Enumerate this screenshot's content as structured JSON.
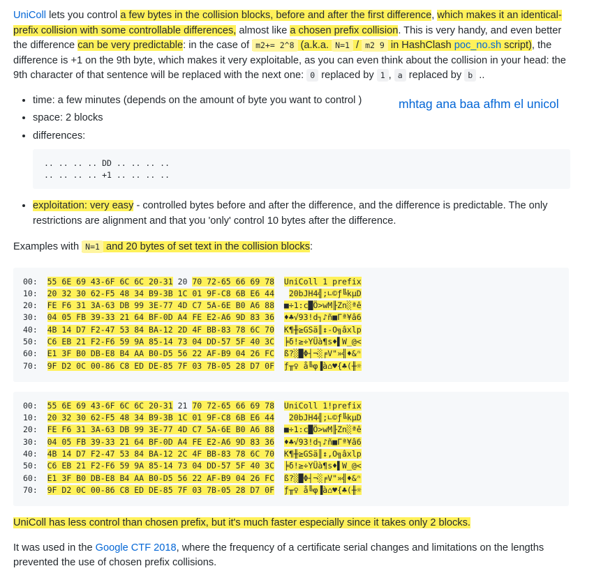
{
  "intro": {
    "unicoll_link": "UniColl",
    "t1": " lets you control ",
    "h1": "a few bytes in the collision blocks, before and after the first difference",
    "t2": ", ",
    "h2": "which makes it an identical-prefix collision with some controllable differences,",
    "t3": " almost like ",
    "h3": "a chosen prefix collision",
    "t4": ". This is very handy, and even better the difference ",
    "h4": "can be very predictable",
    "t5": ": in the case of ",
    "code_m2": "m2+= 2^8",
    "h5a": " (a.k.a. ",
    "code_n1": "N=1",
    "h5b": " / ",
    "code_m29": "m2 9",
    "h5c": " in HashClash ",
    "poc_link": "poc_no.sh",
    "h5d": " script)",
    "t6": ", the difference is +1 on the 9th byte, which makes it very exploitable, as you can even think about the collision in your head: the 9th character of that sentence will be replaced with the next one: ",
    "code_0": "0",
    "t7": " replaced by ",
    "code_1": "1",
    "t8": ", ",
    "code_a": "a",
    "t9": " replaced by ",
    "code_b": "b",
    "t10": " .."
  },
  "bullets": {
    "time": "time: a few minutes (depends on the amount of byte you want to control )",
    "space": "space: 2 blocks",
    "differences": "differences:",
    "diff_line1": ".. .. .. .. DD .. .. .. ..",
    "diff_line2": ".. .. .. .. +1 .. .. .. .."
  },
  "annotation": "mhtag ana baa afhm el unicol",
  "exploitation": {
    "label": "exploitation: very easy",
    "text": " - controlled bytes before and after the difference, and the difference is predictable. The only restrictions are alignment and that you 'only' control 10 bytes after the difference."
  },
  "examples": {
    "t1": "Examples with ",
    "code_n1": "N=1",
    "h1": " and 20 bytes of set text in the collision blocks",
    "t2": ":"
  },
  "hex_block_1": [
    {
      "off": "00:  ",
      "a": "55 6E 69 43-6F 6C 6C 20-31",
      "m": " 20 ",
      "b": "70 72-65 66 69 78",
      "sp": "  ",
      "asc": "UniColl 1 prefix"
    },
    {
      "off": "10:  ",
      "a": "20 32 30 62-F5 48 34 B9-3B 1C 01 9F-C8 6B E6 44",
      "m": "",
      "b": "",
      "sp": "   ",
      "asc": "20bJH4╣;∟©ƒ╚kµD"
    },
    {
      "off": "20:  ",
      "a": "FE F6 31 3A-63 DB 99 3E-77 4D C7 5A-6E B0 A6 88",
      "m": "",
      "b": "",
      "sp": "  ",
      "asc": "■÷1:c█Ö>wM╟Zn░ªê"
    },
    {
      "off": "30:  ",
      "a": "04 05 FB 39-33 21 64 BF-0D A4 FE E2-A6 9D 83 36",
      "m": "",
      "b": "",
      "sp": "  ",
      "asc": "♦♣√93!d┐♪ñ■Γª¥â6"
    },
    {
      "off": "40:  ",
      "a": "4B 14 D7 F2-47 53 84 BA-12 2D 4F BB-83 78 6C 70",
      "m": "",
      "b": "",
      "sp": "  ",
      "asc": "K¶╫≥GSä║↕-O╗âxlp"
    },
    {
      "off": "50:  ",
      "a": "C6 EB 21 F2-F6 59 9A 85-14 73 04 DD-57 5F 40 3C",
      "m": "",
      "b": "",
      "sp": "  ",
      "asc": "╞δ!≥÷YÜà¶s♦▌W_@<"
    },
    {
      "off": "60:  ",
      "a": "E1 3F B0 DB-E8 B4 AA B0-D5 56 22 AF-B9 04 26 FC",
      "m": "",
      "b": "",
      "sp": "  ",
      "asc": "ß?░█Φ┤¬░╒V\"»╣♦&ⁿ"
    },
    {
      "off": "70:  ",
      "a": "9F D2 0C 00-86 C8 ED DE-85 7F 03 7B-05 28 D7 0F",
      "m": "",
      "b": "",
      "sp": "  ",
      "asc": "ƒ╥♀ å╚φ▐à⌂♥{♣(╫☼"
    }
  ],
  "hex_block_2": [
    {
      "off": "00:  ",
      "a": "55 6E 69 43-6F 6C 6C 20-31",
      "m": " 21 ",
      "b": "70 72-65 66 69 78",
      "sp": "  ",
      "asc": "UniColl 1!prefix"
    },
    {
      "off": "10:  ",
      "a": "20 32 30 62-F5 48 34 B9-3B 1C 01 9F-C8 6B E6 44",
      "m": "",
      "b": "",
      "sp": "   ",
      "asc": "20bJH4╣;∟©ƒ╚kµD"
    },
    {
      "off": "20:  ",
      "a": "FE F6 31 3A-63 DB 99 3E-77 4D C7 5A-6E B0 A6 88",
      "m": "",
      "b": "",
      "sp": "  ",
      "asc": "■÷1:c█Ö>wM╟Zn░ªê"
    },
    {
      "off": "30:  ",
      "a": "04 05 FB 39-33 21 64 BF-0D A4 FE E2-A6 9D 83 36",
      "m": "",
      "b": "",
      "sp": "  ",
      "asc": "♦♣√93!d┐♪ñ■Γª¥â6"
    },
    {
      "off": "40:  ",
      "a": "4B 14 D7 F2-47 53 84 BA-12 2C 4F BB-83 78 6C 70",
      "m": "",
      "b": "",
      "sp": "  ",
      "asc": "K¶╫≥GSä║↕,O╗âxlp"
    },
    {
      "off": "50:  ",
      "a": "C6 EB 21 F2-F6 59 9A 85-14 73 04 DD-57 5F 40 3C",
      "m": "",
      "b": "",
      "sp": "  ",
      "asc": "╞δ!≥÷YÜà¶s♦▌W_@<"
    },
    {
      "off": "60:  ",
      "a": "E1 3F B0 DB-E8 B4 AA B0-D5 56 22 AF-B9 04 26 FC",
      "m": "",
      "b": "",
      "sp": "  ",
      "asc": "ß?░█Φ┤¬░╒V\"»╣♦&ⁿ"
    },
    {
      "off": "70:  ",
      "a": "9F D2 0C 00-86 C8 ED DE-85 7F 03 7B-05 28 D7 0F",
      "m": "",
      "b": "",
      "sp": "  ",
      "asc": "ƒ╥♀ å╚φ▐à⌂♥{♣(╫☼"
    }
  ],
  "summary": {
    "u": "U",
    "rest": "niColl has less control than chosen prefix, but it's much faster especially since it takes only 2 blocks."
  },
  "ctf": {
    "t1": "It was used in the ",
    "link": "Google CTF 2018",
    "t2": ", where the frequency of a certificate serial changes and limitations on the lengths prevented the use of chosen prefix collisions."
  },
  "colors": {
    "highlight": "#fff15a",
    "link": "#0366d6",
    "code_bg": "#f6f8fa",
    "text": "#24292e"
  }
}
